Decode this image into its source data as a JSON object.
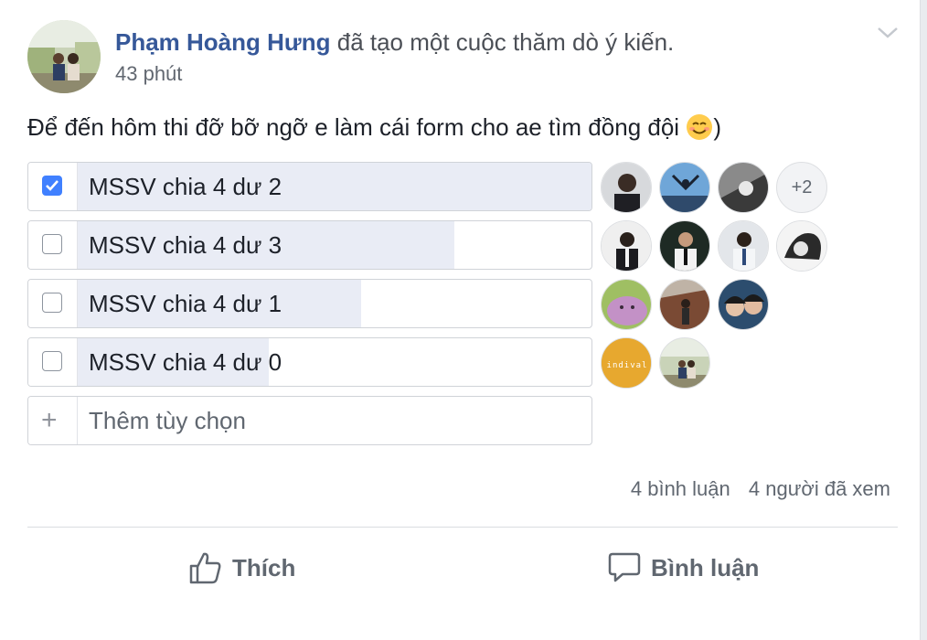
{
  "post": {
    "author": "Phạm Hoàng Hưng",
    "action_text": "đã tạo một cuộc thăm dò ý kiến.",
    "time": "43 phút",
    "text": "Để đến hôm thi đỡ bỡ ngỡ e làm cái form cho ae tìm đồng đội",
    "text_suffix": ")"
  },
  "poll": {
    "options": [
      {
        "label": "MSSV chia 4 dư 2",
        "checked": true,
        "fill": 1.0
      },
      {
        "label": "MSSV chia 4 dư 3",
        "checked": false,
        "fill": 0.73
      },
      {
        "label": "MSSV chia 4 dư 1",
        "checked": false,
        "fill": 0.55
      },
      {
        "label": "MSSV chia 4 dư 0",
        "checked": false,
        "fill": 0.37
      }
    ],
    "more_voters_row1": "+2",
    "add_option_placeholder": "Thêm tùy chọn"
  },
  "stats": {
    "comments": "4 bình luận",
    "views": "4 người đã xem"
  },
  "actions": {
    "like": "Thích",
    "comment": "Bình luận"
  },
  "colors": {
    "link": "#365899",
    "checkbox_checked": "#4080ff",
    "bar_fill": "#e9ecf5"
  },
  "avatar_badge_text": "indival"
}
